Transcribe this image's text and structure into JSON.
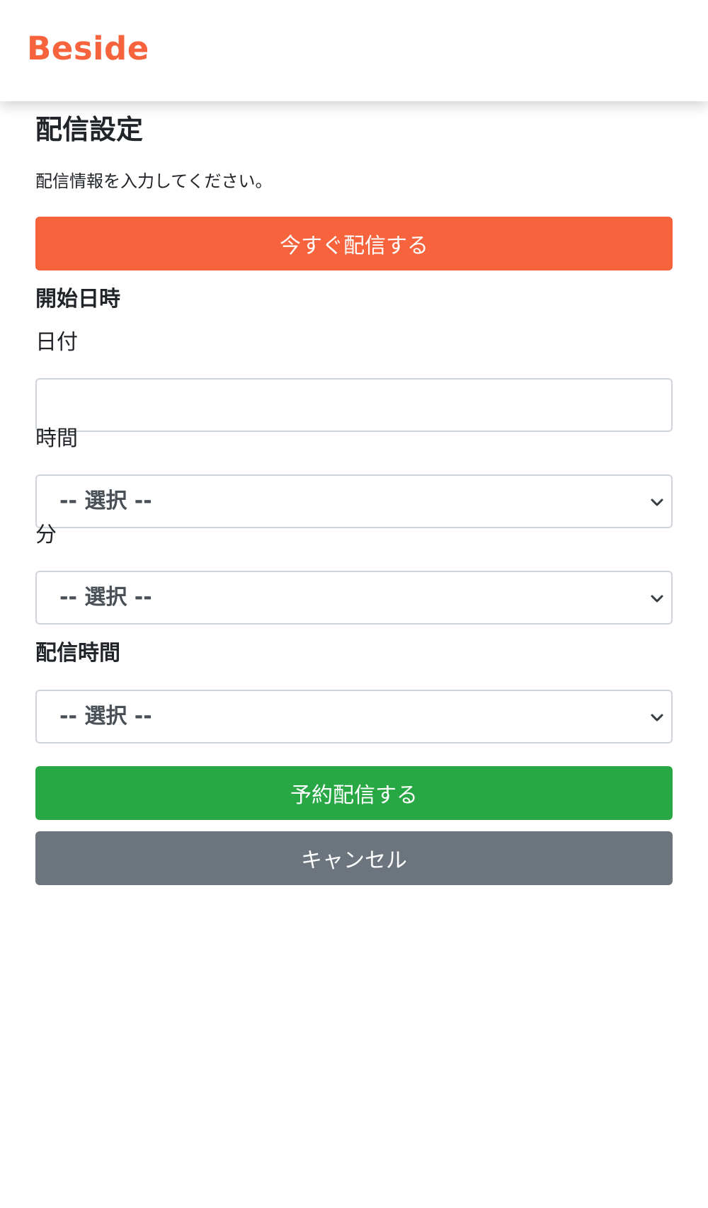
{
  "header": {
    "logo_text": "Beside",
    "brand_color": "#f6633d"
  },
  "page": {
    "title": "配信設定",
    "description": "配信情報を入力してください。"
  },
  "buttons": {
    "deliver_now": "今すぐ配信する",
    "reserve": "予約配信する",
    "cancel": "キャンセル"
  },
  "start_datetime": {
    "section_title": "開始日時",
    "date_label": "日付",
    "date_value": "",
    "hour_label": "時間",
    "hour_selected": "-- 選択 --",
    "minute_label": "分",
    "minute_selected": "-- 選択 --"
  },
  "duration": {
    "section_title": "配信時間",
    "selected": "-- 選択 --"
  },
  "colors": {
    "primary": "#f6633d",
    "success": "#28a745",
    "secondary": "#6c757d",
    "border": "#ced4da"
  },
  "icons": {
    "select_chevron": "chevron-down-icon"
  }
}
